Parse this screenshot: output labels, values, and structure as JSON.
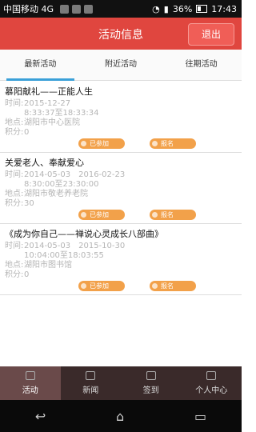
{
  "status_bar": {
    "carrier": "中国移动 4G",
    "battery": "36%",
    "time": "17:43"
  },
  "header": {
    "title": "活动信息",
    "logout": "退出"
  },
  "tabs": [
    "最新活动",
    "附近活动",
    "往期活动"
  ],
  "list": [
    {
      "name": "慕阳献礼——正能人生",
      "time_label": "时间:",
      "time1": "2015-12-27",
      "time2": "8:33:37至18:33:34",
      "place_label": "地点:",
      "place": "湖阳市中心医院",
      "points_label": "积分:",
      "points": "0",
      "btn1": "已参加",
      "btn2": "报名"
    },
    {
      "name": "关爱老人、奉献爱心",
      "time_label": "时间:",
      "time1": "2014-05-03　2016-02-23",
      "time2": "8:30:00至23:30:00",
      "place_label": "地点:",
      "place": "湖阳市敬老养老院",
      "points_label": "积分:",
      "points": "30",
      "btn1": "已参加",
      "btn2": "报名"
    },
    {
      "name": "《成为你自己——禅说心灵成长八部曲》",
      "time_label": "时间:",
      "time1": "2014-05-03　2015-10-30",
      "time2": "10:04:00至18:03:55",
      "place_label": "地点:",
      "place": "湖阳市图书馆",
      "points_label": "积分:",
      "points": "0",
      "btn1": "已参加",
      "btn2": "报名"
    }
  ],
  "bottom_nav": [
    "活动",
    "新闻",
    "签到",
    "个人中心"
  ],
  "sys_nav": {
    "back": "↩",
    "home": "⌂",
    "recent": "▭"
  }
}
